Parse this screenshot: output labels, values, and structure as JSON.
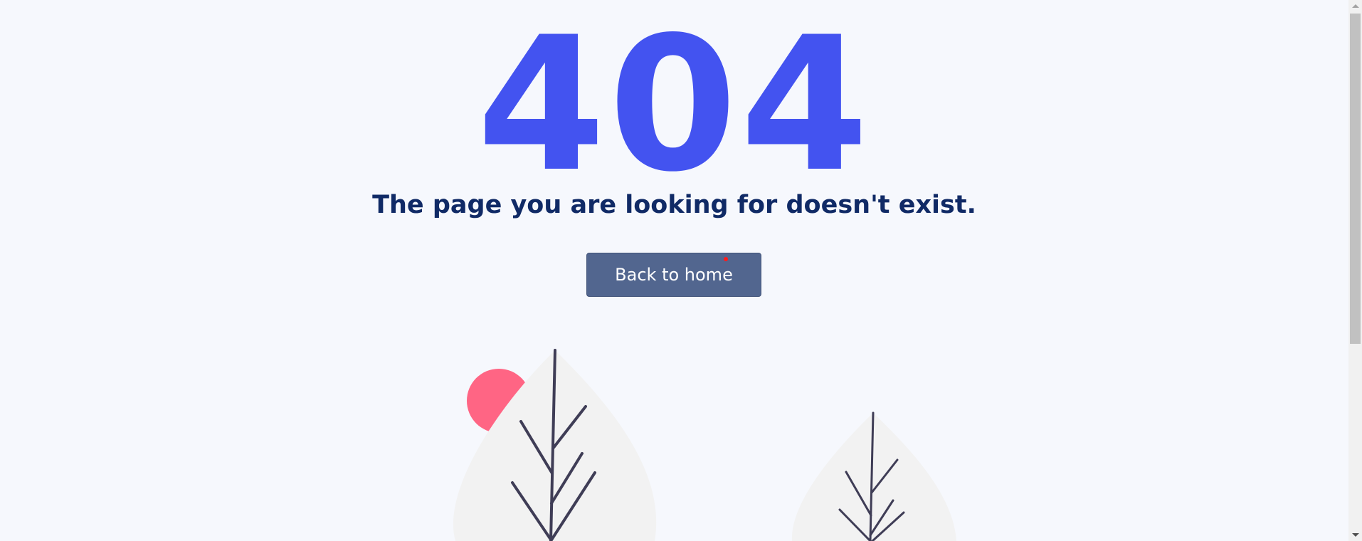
{
  "error": {
    "code": "404",
    "message": "The page you are looking for doesn't exist."
  },
  "actions": {
    "home_label": "Back to home"
  },
  "colors": {
    "background": "#f6f8fd",
    "code": "#4353f0",
    "message": "#102a66",
    "button": "#52668f",
    "sun": "#ff6584",
    "leaf": "#f2f2f2",
    "stem": "#3f3d56"
  },
  "illustration": {
    "subject": "two-leaf-plants-with-sun"
  }
}
